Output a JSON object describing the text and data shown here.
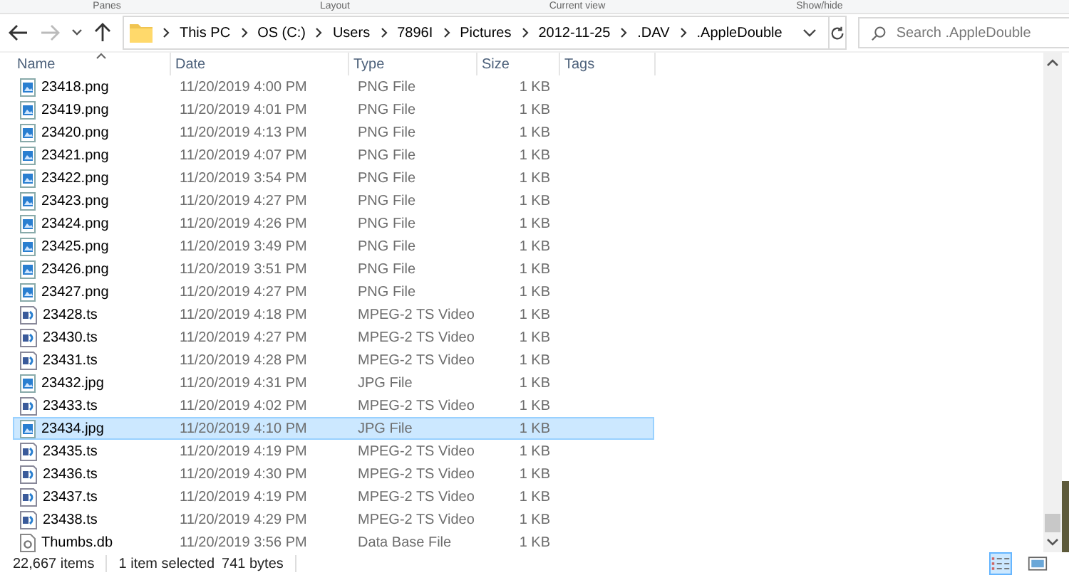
{
  "ribbon_groups": [
    "Panes",
    "Layout",
    "Current view",
    "Show/hide"
  ],
  "nav": {
    "back_disabled": false,
    "forward_disabled": true
  },
  "address": {
    "segments": [
      "This PC",
      "OS (C:)",
      "Users",
      "7896I",
      "Pictures",
      "2012-11-25",
      ".DAV",
      ".AppleDouble"
    ]
  },
  "search": {
    "placeholder": "Search .AppleDouble"
  },
  "columns": [
    "Name",
    "Date",
    "Type",
    "Size",
    "Tags"
  ],
  "rows": [
    {
      "name": "23418.png",
      "date": "11/20/2019 4:00 PM",
      "type": "PNG File",
      "size": "1 KB",
      "kind": "image",
      "selected": false
    },
    {
      "name": "23419.png",
      "date": "11/20/2019 4:01 PM",
      "type": "PNG File",
      "size": "1 KB",
      "kind": "image",
      "selected": false
    },
    {
      "name": "23420.png",
      "date": "11/20/2019 4:13 PM",
      "type": "PNG File",
      "size": "1 KB",
      "kind": "image",
      "selected": false
    },
    {
      "name": "23421.png",
      "date": "11/20/2019 4:07 PM",
      "type": "PNG File",
      "size": "1 KB",
      "kind": "image",
      "selected": false
    },
    {
      "name": "23422.png",
      "date": "11/20/2019 3:54 PM",
      "type": "PNG File",
      "size": "1 KB",
      "kind": "image",
      "selected": false
    },
    {
      "name": "23423.png",
      "date": "11/20/2019 4:27 PM",
      "type": "PNG File",
      "size": "1 KB",
      "kind": "image",
      "selected": false
    },
    {
      "name": "23424.png",
      "date": "11/20/2019 4:26 PM",
      "type": "PNG File",
      "size": "1 KB",
      "kind": "image",
      "selected": false
    },
    {
      "name": "23425.png",
      "date": "11/20/2019 3:49 PM",
      "type": "PNG File",
      "size": "1 KB",
      "kind": "image",
      "selected": false
    },
    {
      "name": "23426.png",
      "date": "11/20/2019 3:51 PM",
      "type": "PNG File",
      "size": "1 KB",
      "kind": "image",
      "selected": false
    },
    {
      "name": "23427.png",
      "date": "11/20/2019 4:27 PM",
      "type": "PNG File",
      "size": "1 KB",
      "kind": "image",
      "selected": false
    },
    {
      "name": "23428.ts",
      "date": "11/20/2019 4:18 PM",
      "type": "MPEG-2 TS Video",
      "size": "1 KB",
      "kind": "video",
      "selected": false
    },
    {
      "name": "23430.ts",
      "date": "11/20/2019 4:27 PM",
      "type": "MPEG-2 TS Video",
      "size": "1 KB",
      "kind": "video",
      "selected": false
    },
    {
      "name": "23431.ts",
      "date": "11/20/2019 4:28 PM",
      "type": "MPEG-2 TS Video",
      "size": "1 KB",
      "kind": "video",
      "selected": false
    },
    {
      "name": "23432.jpg",
      "date": "11/20/2019 4:31 PM",
      "type": "JPG File",
      "size": "1 KB",
      "kind": "image",
      "selected": false
    },
    {
      "name": "23433.ts",
      "date": "11/20/2019 4:02 PM",
      "type": "MPEG-2 TS Video",
      "size": "1 KB",
      "kind": "video",
      "selected": false
    },
    {
      "name": "23434.jpg",
      "date": "11/20/2019 4:10 PM",
      "type": "JPG File",
      "size": "1 KB",
      "kind": "image",
      "selected": true
    },
    {
      "name": "23435.ts",
      "date": "11/20/2019 4:19 PM",
      "type": "MPEG-2 TS Video",
      "size": "1 KB",
      "kind": "video",
      "selected": false
    },
    {
      "name": "23436.ts",
      "date": "11/20/2019 4:30 PM",
      "type": "MPEG-2 TS Video",
      "size": "1 KB",
      "kind": "video",
      "selected": false
    },
    {
      "name": "23437.ts",
      "date": "11/20/2019 4:19 PM",
      "type": "MPEG-2 TS Video",
      "size": "1 KB",
      "kind": "video",
      "selected": false
    },
    {
      "name": "23438.ts",
      "date": "11/20/2019 4:29 PM",
      "type": "MPEG-2 TS Video",
      "size": "1 KB",
      "kind": "video",
      "selected": false
    },
    {
      "name": "Thumbs.db",
      "date": "11/20/2019 3:56 PM",
      "type": "Data Base File",
      "size": "1 KB",
      "kind": "database",
      "selected": false
    }
  ],
  "status_bar": {
    "items": "22,667 items",
    "selection": "1 item selected",
    "size": "741 bytes"
  },
  "views": [
    {
      "kind": "details",
      "selected": true
    },
    {
      "kind": "large-icons",
      "selected": false
    }
  ]
}
